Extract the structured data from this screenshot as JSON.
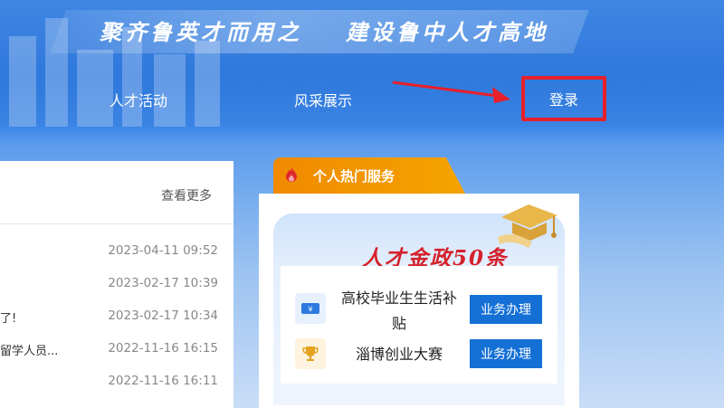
{
  "header": {
    "slogan_left": "聚齐鲁英才而用之",
    "slogan_right": "建设鲁中人才高地",
    "nav": {
      "activities": "人才活动",
      "showcase": "风采展示",
      "login": "登录"
    }
  },
  "news": {
    "more": "查看更多",
    "rows": [
      {
        "title": "",
        "date": "2023-04-11 09:52"
      },
      {
        "title": "",
        "date": "2023-02-17 10:39"
      },
      {
        "title": "了!",
        "date": "2023-02-17 10:34"
      },
      {
        "title": "留学人员...",
        "date": "2022-11-16 16:15"
      },
      {
        "title": "",
        "date": "2022-11-16 16:11"
      }
    ]
  },
  "services": {
    "tab_label": "个人热门服务",
    "policy_title": "人才金政50条",
    "items": [
      {
        "name": "高校毕业生生活补贴",
        "action": "业务办理",
        "icon": "subsidy-ticket-icon"
      },
      {
        "name": "淄博创业大赛",
        "action": "业务办理",
        "icon": "trophy-icon"
      }
    ]
  },
  "colors": {
    "header_blue": "#2f78dc",
    "highlight_red": "#e8202a",
    "tab_orange": "#f08a00",
    "button_blue": "#1570d6",
    "policy_red": "#d5212b"
  }
}
